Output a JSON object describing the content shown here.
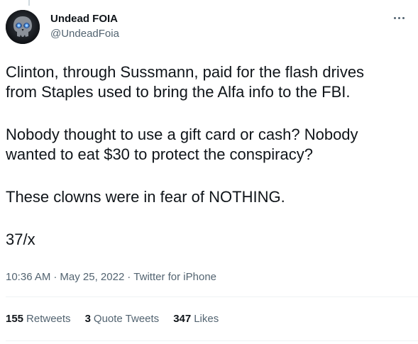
{
  "author": {
    "display_name": "Undead FOIA",
    "handle": "@UndeadFoia",
    "avatar_icon": "skull-avatar-icon"
  },
  "tweet": {
    "paragraphs": [
      "Clinton, through Sussmann, paid for the flash drives\nfrom Staples used to bring the Alfa info to the FBI.",
      "Nobody thought to use a gift card or cash? Nobody\nwanted to eat $30 to protect the conspiracy?",
      "These clowns were in fear of NOTHING.",
      "37/x"
    ],
    "time": "10:36 AM",
    "date": "May 25, 2022",
    "source": "Twitter for iPhone",
    "separator": "·"
  },
  "stats": {
    "retweets_count": "155",
    "retweets_label": "Retweets",
    "quotes_count": "3",
    "quotes_label": "Quote Tweets",
    "likes_count": "347",
    "likes_label": "Likes"
  },
  "colors": {
    "text": "#0f1419",
    "secondary": "#536471",
    "divider": "#eff3f4",
    "avatar_glow": "#3b82f6"
  }
}
